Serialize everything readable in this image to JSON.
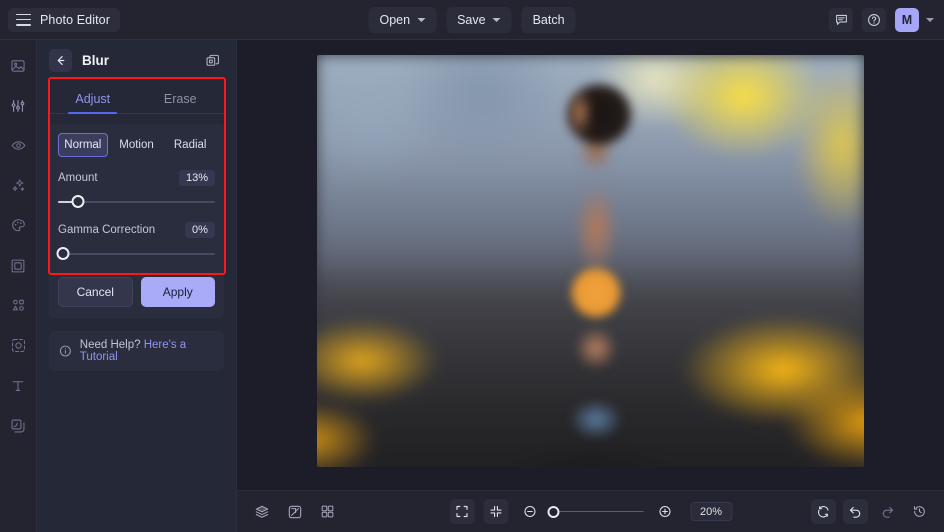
{
  "topbar": {
    "brand": "Photo Editor",
    "menu_icon": "hamburger-icon",
    "buttons": [
      {
        "label": "Open",
        "has_caret": true
      },
      {
        "label": "Save",
        "has_caret": true
      },
      {
        "label": "Batch",
        "has_caret": false
      }
    ],
    "right_icons": [
      "feedback-icon",
      "help-icon"
    ],
    "avatar_initial": "M"
  },
  "rail": {
    "items": [
      {
        "name": "image-icon"
      },
      {
        "name": "adjust-sliders-icon"
      },
      {
        "name": "eye-retouch-icon"
      },
      {
        "name": "sparkles-effects-icon"
      },
      {
        "name": "palette-color-icon"
      },
      {
        "name": "frame-icon"
      },
      {
        "name": "shapes-icon"
      },
      {
        "name": "focus-blur-icon"
      },
      {
        "name": "text-icon"
      },
      {
        "name": "layers-overlay-icon"
      }
    ]
  },
  "panel": {
    "title": "Blur",
    "back_icon": "arrow-left-icon",
    "duplicate_icon": "duplicate-icon",
    "tabs": [
      {
        "label": "Adjust",
        "active": true
      },
      {
        "label": "Erase",
        "active": false
      }
    ],
    "modes": [
      {
        "label": "Normal",
        "active": true
      },
      {
        "label": "Motion",
        "active": false
      },
      {
        "label": "Radial",
        "active": false
      }
    ],
    "sliders": [
      {
        "label": "Amount",
        "value": "13%",
        "percent": 13
      },
      {
        "label": "Gamma Correction",
        "value": "0%",
        "percent": 0
      }
    ],
    "cancel_label": "Cancel",
    "apply_label": "Apply",
    "help_prefix": "Need Help? ",
    "help_link": "Here's a Tutorial",
    "help_icon": "info-icon",
    "highlight_color": "#ff1616",
    "accent_color": "#5865f2",
    "apply_color": "#a9aaf8"
  },
  "bottombar": {
    "left_icons": [
      "layers-icon",
      "compare-icon",
      "grid-icon"
    ],
    "center_icons": [
      "fit-screen-icon",
      "actual-size-icon"
    ],
    "zoom_out_icon": "zoom-out-icon",
    "zoom_in_icon": "zoom-in-icon",
    "zoom_value": "20%",
    "right_icons": [
      "reset-icon",
      "undo-icon",
      "redo-icon",
      "history-icon"
    ]
  }
}
